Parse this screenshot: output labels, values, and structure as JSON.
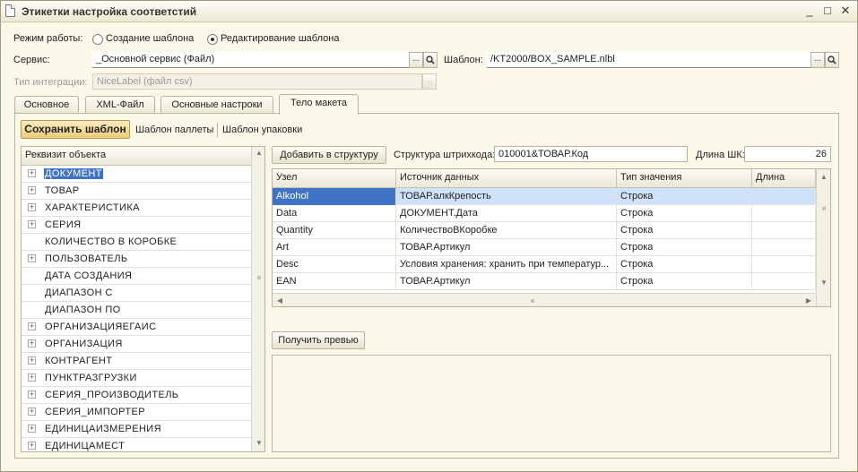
{
  "window": {
    "title": "Этикетки настройка соответстий",
    "min_glyph": "_",
    "max_glyph": "□",
    "close_glyph": "✕"
  },
  "mode": {
    "label": "Режим работы:",
    "options": [
      {
        "label": "Создание шаблона",
        "selected": false
      },
      {
        "label": "Редактирование шаблона",
        "selected": true
      }
    ]
  },
  "service": {
    "label": "Сервис:",
    "value": "_Основной сервис (Файл)",
    "choose_glyph": "...",
    "open_glyph": "🔍"
  },
  "template": {
    "label": "Шаблон:",
    "value": "/KT2000/BOX_SAMPLE.nlbl",
    "choose_glyph": "...",
    "open_glyph": "🔍"
  },
  "integration": {
    "label": "Тип интеграции:",
    "value": "NiceLabel (файл csv)",
    "choose_glyph": "..."
  },
  "tabs": [
    {
      "label": "Основное",
      "active": false
    },
    {
      "label": "XML-Файл",
      "active": false
    },
    {
      "label": "Основные настроки",
      "active": false
    },
    {
      "label": "Тело макета",
      "active": true
    }
  ],
  "toolbar": {
    "save_label": "Сохранить шаблон",
    "pallet_label": "Шаблон паллеты",
    "pack_label": "Шаблон упаковки"
  },
  "tree": {
    "header": "Реквизит объекта",
    "items": [
      {
        "label": "ДОКУМЕНТ",
        "expandable": true,
        "selected": true
      },
      {
        "label": "ТОВАР",
        "expandable": true
      },
      {
        "label": "ХАРАКТЕРИСТИКА",
        "expandable": true
      },
      {
        "label": "СЕРИЯ",
        "expandable": true
      },
      {
        "label": "КОЛИЧЕСТВО В КОРОБКЕ",
        "expandable": false
      },
      {
        "label": "ПОЛЬЗОВАТЕЛЬ",
        "expandable": true
      },
      {
        "label": "ДАТА СОЗДАНИЯ",
        "expandable": false
      },
      {
        "label": "ДИАПАЗОН С",
        "expandable": false
      },
      {
        "label": "ДИАПАЗОН ПО",
        "expandable": false
      },
      {
        "label": "ОРГАНИЗАЦИЯЕГАИС",
        "expandable": true
      },
      {
        "label": "ОРГАНИЗАЦИЯ",
        "expandable": true
      },
      {
        "label": "КОНТРАГЕНТ",
        "expandable": true
      },
      {
        "label": "ПУНКТРАЗГРУЗКИ",
        "expandable": true
      },
      {
        "label": "СЕРИЯ_ПРОИЗВОДИТЕЛЬ",
        "expandable": true
      },
      {
        "label": "СЕРИЯ_ИМПОРТЕР",
        "expandable": true
      },
      {
        "label": "ЕДИНИЦАИЗМЕРЕНИЯ",
        "expandable": true
      },
      {
        "label": "ЕДИНИЦАМЕСТ",
        "expandable": true
      }
    ]
  },
  "structure": {
    "add_label": "Добавить в структуру",
    "barcode_label": "Структура штрихкода:",
    "barcode_value": "010001&ТОВАР.Код",
    "length_label": "Длина ШК:",
    "length_value": "26"
  },
  "grid": {
    "columns": [
      "Узел",
      "Источник данных",
      "Тип значения",
      "Длина"
    ],
    "rows": [
      {
        "node": "Alkohol",
        "source": "ТОВАР.алкКрепость",
        "type": "Строка",
        "length": "",
        "selected": true
      },
      {
        "node": "Data",
        "source": "ДОКУМЕНТ.Дата",
        "type": "Строка",
        "length": ""
      },
      {
        "node": "Quantity",
        "source": "КоличествоВКоробке",
        "type": "Строка",
        "length": ""
      },
      {
        "node": "Art",
        "source": "ТОВАР.Артикул",
        "type": "Строка",
        "length": ""
      },
      {
        "node": "Desc",
        "source": "Условия хранения: хранить при температур...",
        "type": "Строка",
        "length": ""
      },
      {
        "node": "EAN",
        "source": "ТОВАР.Артикул",
        "type": "Строка",
        "length": ""
      }
    ]
  },
  "preview": {
    "button_label": "Получить превью"
  },
  "icons": {
    "expand": "plus-box-icon",
    "scroll_up": "arrow-up-icon",
    "scroll_down": "arrow-down-icon",
    "scroll_left": "arrow-left-icon",
    "scroll_right": "arrow-right-icon"
  },
  "colors": {
    "selection": "#3e73c6",
    "row_highlight": "#cfe2fb",
    "primary_button": "#eccc7a",
    "background": "#fbf8ea"
  }
}
